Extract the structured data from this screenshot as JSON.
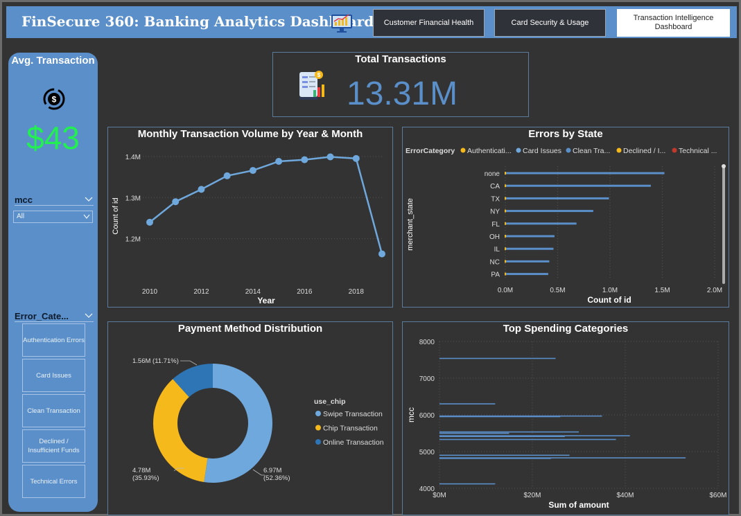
{
  "header": {
    "title": "FinSecure 360: Banking Analytics Dashboard",
    "nav": [
      {
        "label": "Customer Financial Health",
        "active": false
      },
      {
        "label": "Card Security & Usage",
        "active": false
      },
      {
        "label": "Transaction Intelligence Dashboard",
        "active": true
      }
    ]
  },
  "sidebar": {
    "avg_label": "Avg. Transaction",
    "avg_value": "$43",
    "mcc_slicer": {
      "title": "mcc",
      "value": "All"
    },
    "error_slicer": {
      "title": "Error_Cate...",
      "options": [
        "Authentication Errors",
        "Card Issues",
        "Clean Transaction",
        "Declined / Insufficient Funds",
        "Technical Errors"
      ]
    }
  },
  "kpi": {
    "title": "Total Transactions",
    "value": "13.31M"
  },
  "colors": {
    "accent": "#5b8fc9",
    "green": "#22ef52",
    "line": "#6fa8dc",
    "yellow": "#f6b91c",
    "online": "#2e75b6",
    "red": "#c0392b"
  },
  "chart_data": [
    {
      "type": "line",
      "title": "Monthly Transaction Volume by Year & Month",
      "xlabel": "Year",
      "ylabel": "Count of id",
      "x": [
        2010,
        2011,
        2012,
        2013,
        2014,
        2015,
        2016,
        2017,
        2018,
        2019
      ],
      "values": [
        1.24,
        1.29,
        1.32,
        1.353,
        1.366,
        1.388,
        1.392,
        1.399,
        1.395,
        1.163
      ],
      "x_ticks": [
        "2010",
        "2012",
        "2014",
        "2016",
        "2018"
      ],
      "y_ticks": [
        "1.2M",
        "1.3M",
        "1.4M"
      ],
      "ylim": [
        1.1,
        1.42
      ],
      "grid": true
    },
    {
      "type": "bar",
      "orientation": "horizontal",
      "title": "Errors by State",
      "xlabel": "Count of id",
      "ylabel": "merchant_state",
      "legend_title": "ErrorCategory",
      "legend": [
        {
          "name": "Authenticati...",
          "color": "#f6b91c"
        },
        {
          "name": "Card Issues",
          "color": "#6fa8dc"
        },
        {
          "name": "Clean Tra...",
          "color": "#5b8fc9"
        },
        {
          "name": "Declined / I...",
          "color": "#f6b91c"
        },
        {
          "name": "Technical ...",
          "color": "#c0392b"
        }
      ],
      "categories": [
        "none",
        "CA",
        "TX",
        "NY",
        "FL",
        "OH",
        "IL",
        "NC",
        "PA"
      ],
      "values": [
        1.52,
        1.39,
        0.99,
        0.84,
        0.68,
        0.47,
        0.46,
        0.42,
        0.41
      ],
      "x_ticks": [
        "0.0M",
        "0.5M",
        "1.0M",
        "1.5M",
        "2.0M"
      ],
      "xlim": [
        0,
        2.0
      ],
      "grid": true
    },
    {
      "type": "pie",
      "style": "donut",
      "title": "Payment Method Distribution",
      "legend_title": "use_chip",
      "slices": [
        {
          "name": "Swipe Transaction",
          "value": 6.97,
          "label": "6.97M\n(52.36%)",
          "pct": 52.36,
          "color": "#6fa8dc"
        },
        {
          "name": "Chip Transaction",
          "value": 4.78,
          "label": "4.78M\n(35.93%)",
          "pct": 35.93,
          "color": "#f6b91c"
        },
        {
          "name": "Online Transaction",
          "value": 1.56,
          "label": "1.56M (11.71%)",
          "pct": 11.71,
          "color": "#2e75b6"
        }
      ]
    },
    {
      "type": "bar",
      "orientation": "horizontal",
      "title": "Top Spending Categories",
      "xlabel": "Sum of amount",
      "ylabel": "mcc",
      "x_ticks": [
        "$0M",
        "$20M",
        "$40M",
        "$60M"
      ],
      "y_ticks": [
        "8000",
        "7000",
        "6000",
        "5000",
        "4000"
      ],
      "xlim": [
        0,
        60
      ],
      "ylim": [
        4000,
        8000
      ],
      "bars": [
        {
          "mcc": 7538,
          "amount": 25
        },
        {
          "mcc": 6300,
          "amount": 12
        },
        {
          "mcc": 5968,
          "amount": 35
        },
        {
          "mcc": 5952,
          "amount": 26
        },
        {
          "mcc": 5535,
          "amount": 30
        },
        {
          "mcc": 5499,
          "amount": 15
        },
        {
          "mcc": 5431,
          "amount": 41
        },
        {
          "mcc": 5411,
          "amount": 27
        },
        {
          "mcc": 5330,
          "amount": 38
        },
        {
          "mcc": 4900,
          "amount": 28
        },
        {
          "mcc": 4829,
          "amount": 53
        },
        {
          "mcc": 4814,
          "amount": 24
        },
        {
          "mcc": 4121,
          "amount": 12
        }
      ],
      "grid": true
    }
  ]
}
